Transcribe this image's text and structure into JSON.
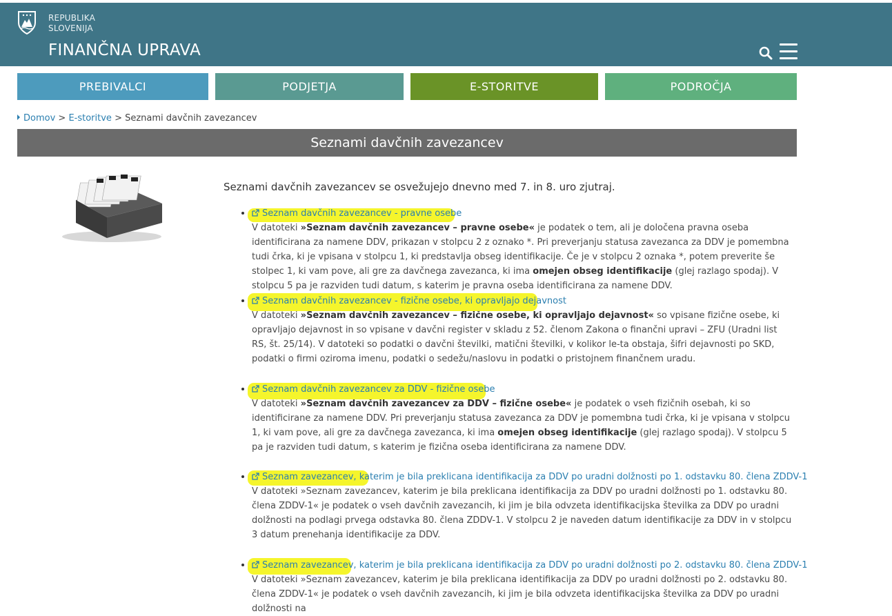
{
  "header": {
    "republika_line1": "REPUBLIKA",
    "republika_line2": "SLOVENIJA",
    "title": "FINANČNA UPRAVA",
    "search_icon": "search-icon",
    "menu_icon": "hamburger-menu-icon",
    "background": "#3f7587"
  },
  "nav": {
    "items": [
      {
        "label": "PREBIVALCI",
        "color": "#4d9bbd"
      },
      {
        "label": "PODJETJA",
        "color": "#5a9a92"
      },
      {
        "label": "E-STORITVE",
        "color": "#6a9327"
      },
      {
        "label": "PODROČJA",
        "color": "#5fb07e"
      }
    ]
  },
  "breadcrumb": {
    "home": "Domov",
    "sep1": " > ",
    "section": "E-storitve",
    "sep2": " > ",
    "current": "Seznami davčnih zavezancev"
  },
  "page_title": "Seznami davčnih zavezancev",
  "intro": "Seznami davčnih zavezancev se osvežujejo dnevno med 7. in 8. uro zjutraj.",
  "items": [
    {
      "link": "Seznam davčnih zavezancev - pravne osebe",
      "desc_pre": "V datoteki ",
      "desc_bold": "»Seznam davčnih zavezancev – pravne osebe«",
      "desc_mid": " je podatek o tem, ali je določena pravna oseba identificirana za namene DDV, prikazan v stolpcu 2 z oznako *. Pri preverjanju statusa zavezanca za DDV je pomembna tudi črka, ki je vpisana v stolpcu 1, ki predstavlja obseg identifikacije. Če je v stolpcu 2 oznaka *, potem preverite še stolpec 1, ki vam pove, ali gre za davčnega zavezanca, ki ima ",
      "desc_bold2": "omejen obseg identifikacije",
      "desc_post": " (glej razlago spodaj). V stolpcu 5 pa je razviden tudi datum, s katerim je pravna oseba identificirana za namene DDV."
    },
    {
      "link": "Seznam davčnih zavezancev - fizične osebe, ki opravljajo dejavnost",
      "desc_pre": "V datoteki ",
      "desc_bold": "»Seznam davčnih zavezancev – fizične osebe, ki opravljajo dejavnost«",
      "desc_mid": " so vpisane fizične osebe, ki opravljajo dejavnost in so vpisane v davčni register v skladu z 52. členom Zakona o finančni upravi – ZFU (Uradni list RS, št. 25/14). V datoteki so podatki o davčni številki, matični številki, v kolikor le-ta obstaja, šifri dejavnosti po SKD, podatki o firmi oziroma imenu, podatki o sedežu/naslovu in podatki o pristojnem finančnem uradu.",
      "desc_bold2": "",
      "desc_post": ""
    },
    {
      "link": "Seznam davčnih zavezancev za DDV - fizične osebe",
      "desc_pre": "V datoteki ",
      "desc_bold": "»Seznam davčnih zavezancev za DDV – fizične osebe«",
      "desc_mid": " je podatek o vseh fizičnih osebah, ki so identificirane za namene DDV. Pri preverjanju statusa zavezanca za DDV je pomembna tudi črka, ki je vpisana v stolpcu 1, ki vam pove, ali gre za davčnega zavezanca, ki ima ",
      "desc_bold2": "omejen obseg identifikacije",
      "desc_post": " (glej razlago spodaj). V stolpcu 5 pa je razviden tudi datum, s katerim je fizična oseba identificirana za namene DDV."
    },
    {
      "link": "Seznam zavezancev, katerim je bila preklicana identifikacija za DDV po uradni dolžnosti po 1. odstavku 80. člena ZDDV-1",
      "desc_pre": "V datoteki »Seznam zavezancev, katerim je bila preklicana identifikacija za DDV po uradni dolžnosti po 1. odstavku 80. člena ZDDV-1« je podatek o vseh davčnih zavezancih, ki jim je bila odvzeta identifikacijska številka za DDV po uradni dolžnosti na podlagi prvega odstavka 80. člena ZDDV-1. V stolpcu 2 je naveden datum identifikacije za DDV in v stolpcu 3 datum prenehanja identifikacije za DDV.",
      "desc_bold": "",
      "desc_mid": "",
      "desc_bold2": "",
      "desc_post": ""
    },
    {
      "link": "Seznam zavezancev, katerim je bila preklicana identifikacija za DDV po uradni dolžnosti po 2. odstavku 80. člena ZDDV-1",
      "desc_pre": "V datoteki »Seznam zavezancev, katerim je bila preklicana identifikacija za DDV po uradni dolžnosti po 2. odstavku 80. člena ZDDV-1« je podatek o vseh davčnih zavezancih, ki jim je bila odvzeta identifikacijska številka za DDV po uradni dolžnosti na",
      "desc_bold": "",
      "desc_mid": "",
      "desc_bold2": "",
      "desc_post": ""
    }
  ],
  "highlight_color": "#f4f41a",
  "link_color": "#2b7fb0"
}
